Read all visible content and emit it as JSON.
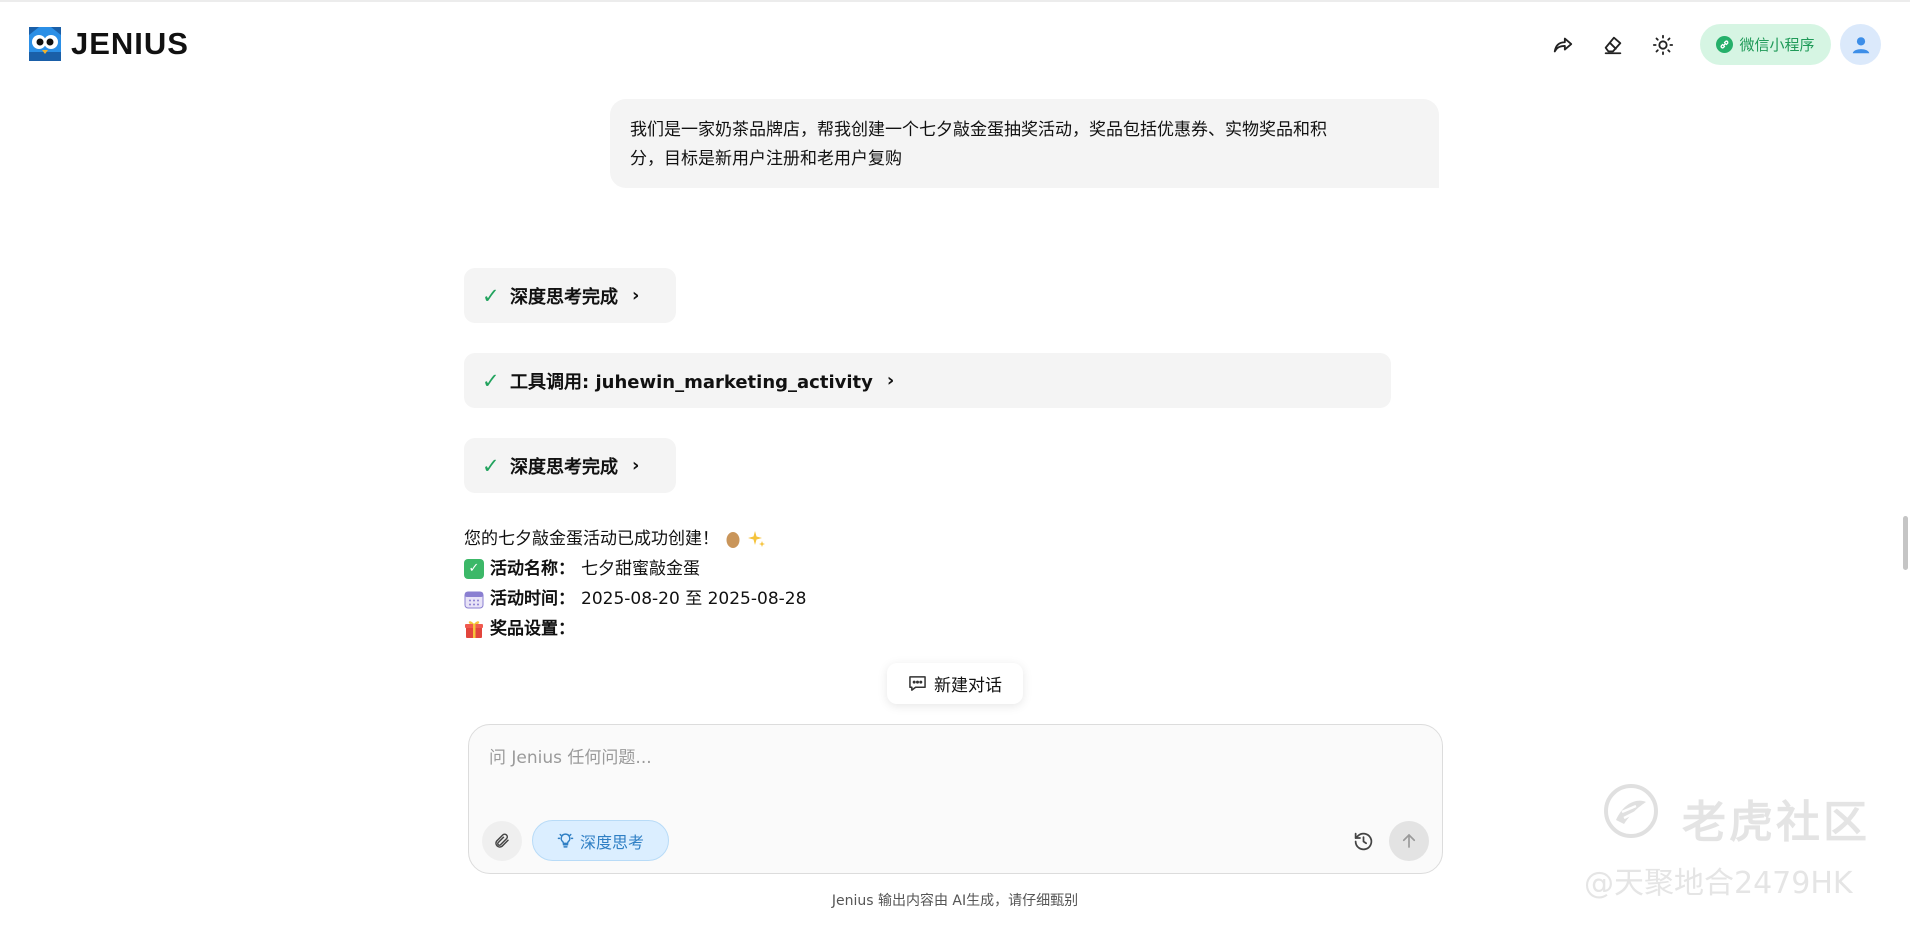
{
  "header": {
    "logo_text": "JENIUS",
    "mini_program_label": "微信小程序",
    "icons": [
      "share-icon",
      "eraser-icon",
      "sun-icon",
      "user-icon"
    ]
  },
  "conversation": {
    "user_message_line1": "我们是一家奶茶品牌店，帮我创建一个七夕敲金蛋抽奖活动，奖品包括优惠券、实物奖品和积",
    "user_message_line2": "分，目标是新用户注册和老用户复购",
    "steps": [
      {
        "label": "深度思考完成"
      },
      {
        "label": "工具调用: juhewin_marketing_activity"
      },
      {
        "label": "深度思考完成"
      }
    ],
    "answer": {
      "intro": "您的七夕敲金蛋活动已成功创建！",
      "name_label": "活动名称：",
      "name_value": "七夕甜蜜敲金蛋",
      "time_label": "活动时间：",
      "time_value": "2025-08-20 至 2025-08-28",
      "prize_label": "奖品设置："
    }
  },
  "new_chat_label": "新建对话",
  "composer": {
    "placeholder": "问 Jenius 任何问题...",
    "deep_think_label": "深度思考"
  },
  "footer_note": "Jenius 输出内容由 AI生成，请仔细甄别",
  "watermark": {
    "line1": "老虎社区",
    "line2": "@天聚地合2479HK"
  },
  "colors": {
    "accent_green": "#22a35e",
    "mini_program_bg": "#d6f5e3",
    "deep_think_blue": "#2f7fc4"
  }
}
